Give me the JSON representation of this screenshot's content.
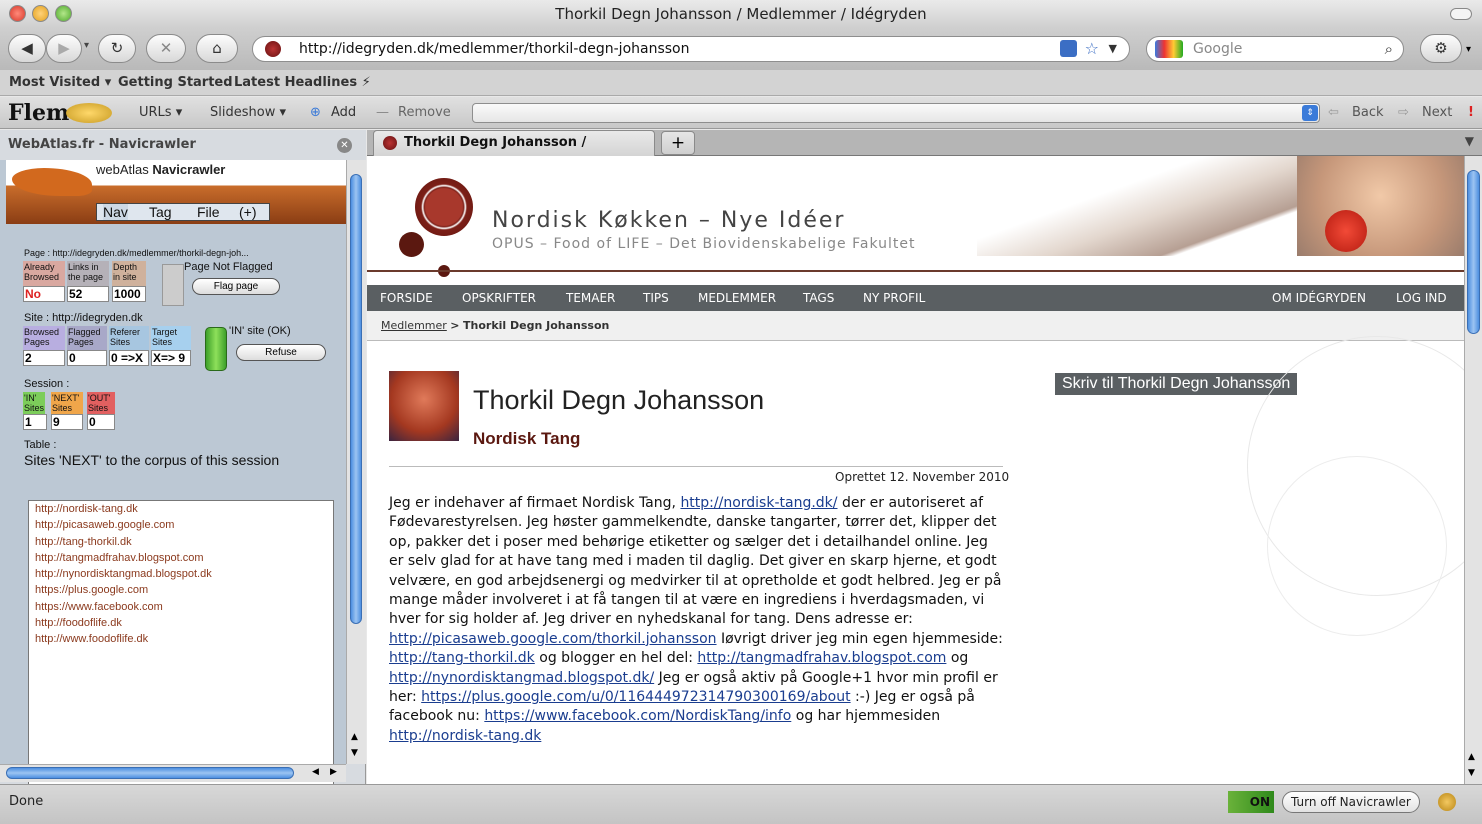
{
  "window": {
    "title": "Thorkil Degn Johansson / Medlemmer / Idégryden"
  },
  "toolbar": {
    "url": "http://idegryden.dk/medlemmer/thorkil-degn-johansson",
    "search_placeholder": "Google"
  },
  "bookmarks": {
    "items": [
      "Most Visited ▾",
      "Getting Started",
      "Latest Headlines ⚡"
    ]
  },
  "flem": {
    "logo": "Flem",
    "urls": "URLs ▾",
    "slideshow": "Slideshow ▾",
    "add": "Add",
    "remove": "Remove",
    "back": "Back",
    "next": "Next"
  },
  "sidebar": {
    "header": "WebAtlas.fr - Navicrawler",
    "brand": "webAtlas",
    "brand_bold": "Navicrawler",
    "tabs": [
      "Nav",
      "Tag",
      "File",
      "(+)"
    ],
    "page_line": "Page : http://idegryden.dk/medlemmer/thorkil-degn-joh...",
    "page_labels": [
      "Already Browsed",
      "Links in the page",
      "Depth in site"
    ],
    "page_values": [
      "No",
      "52",
      "1000"
    ],
    "flag_status": "Page Not Flagged",
    "flag_button": "Flag page",
    "site_line": "Site : http://idegryden.dk",
    "site_labels": [
      "Browsed Pages",
      "Flagged Pages",
      "Referer Sites",
      "Target Sites"
    ],
    "site_values": [
      "2",
      "0",
      "0 =>X",
      "X=> 9"
    ],
    "in_site": "'IN' site (OK)",
    "refuse_button": "Refuse",
    "session_label": "Session :",
    "session_labels": [
      "'IN' Sites",
      "'NEXT' Sites",
      "'OUT' Sites"
    ],
    "session_values": [
      "1",
      "9",
      "0"
    ],
    "table_label": "Table :",
    "table_title": "Sites 'NEXT' to the corpus of this session",
    "sites": [
      "http://nordisk-tang.dk",
      "http://picasaweb.google.com",
      "http://tang-thorkil.dk",
      "http://tangmadfrahav.blogspot.com",
      "http://nynordisktangmad.blogspot.dk",
      "https://plus.google.com",
      "https://www.facebook.com",
      "http://foodoflife.dk",
      "http://www.foodoflife.dk"
    ]
  },
  "tab": {
    "label": "Thorkil Degn Johansson / Medlem...",
    "new_tab": "+"
  },
  "site": {
    "title": "Nordisk Køkken – Nye Idéer",
    "subtitle": "OPUS – Food of LIFE – Det Biovidenskabelige Fakultet",
    "nav_left": [
      "FORSIDE",
      "OPSKRIFTER",
      "TEMAER",
      "TIPS",
      "MEDLEMMER",
      "TAGS",
      "NY PROFIL"
    ],
    "nav_right": [
      "OM IDÉGRYDEN",
      "LOG IND"
    ],
    "breadcrumb_link": "Medlemmer",
    "breadcrumb_sep": ">",
    "breadcrumb_current": "Thorkil Degn Johansson"
  },
  "profile": {
    "name": "Thorkil Degn Johansson",
    "company": "Nordisk Tang",
    "created": "Oprettet 12. November 2010",
    "write_button": "Skriv til Thorkil Degn Johansson",
    "p": [
      "Jeg er indehaver af firmaet Nordisk Tang, ",
      "http://nordisk-tang.dk/",
      " der er autoriseret af Fødevarestyrelsen. Jeg høster gammelkendte, danske tangarter, tørrer det, klipper det op, pakker det i poser med behørige etiketter og sælger det i detailhandel online. Jeg er selv glad for at have tang med i maden til daglig. Det giver en skarp hjerne, et godt velvære, en god arbejdsenergi og medvirker til at opretholde et godt helbred. Jeg er på mange måder involveret i at få tangen til at være en ingrediens i hverdagsmaden, vi hver for sig holder af. Jeg driver en nyhedskanal for tang. Dens adresse er: ",
      "http://picasaweb.google.com/thorkil.johansson",
      " Iøvrigt driver jeg min egen hjemmeside: ",
      "http://tang-thorkil.dk",
      " og blogger en hel del: ",
      "http://tangmadfrahav.blogspot.com",
      " og ",
      "http://nynordisktangmad.blogspot.dk/",
      " Jeg er også aktiv på Google+1 hvor min profil er her: ",
      "https://plus.google.com/u/0/116444972314790300169/about",
      " :-) Jeg er også på facebook nu: ",
      "https://www.facebook.com/NordiskTang/info",
      " og har hjemmesiden ",
      "http://nordisk-tang.dk"
    ]
  },
  "status": {
    "text": "Done",
    "on_badge": "ON",
    "turn_off": "Turn off Navicrawler"
  }
}
